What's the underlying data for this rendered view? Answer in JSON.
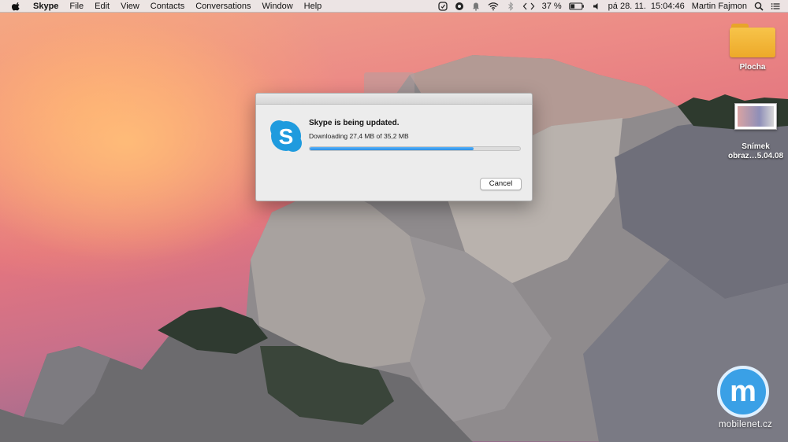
{
  "menubar": {
    "apple_icon": "apple-icon",
    "app_name": "Skype",
    "menus": [
      "File",
      "Edit",
      "View",
      "Contacts",
      "Conversations",
      "Window",
      "Help"
    ],
    "status_icons": [
      "skype-status-icon",
      "compass-icon",
      "notification-icon",
      "wifi-icon",
      "bluetooth-icon",
      "code-brackets-icon"
    ],
    "battery_percent": "37 %",
    "battery_level": 0.37,
    "volume_icon": "speaker-icon",
    "datetime": "pá 28. 11.  15:04:46",
    "user_name": "Martin Fajmon",
    "search_icon": "spotlight-search-icon",
    "notification_center_icon": "list-icon"
  },
  "desktop_icons": [
    {
      "type": "folder",
      "label": "Plocha"
    },
    {
      "type": "screenshot",
      "label_line1": "Snímek",
      "label_line2": "obraz…5.04.08"
    }
  ],
  "dialog": {
    "icon": "skype-logo-icon",
    "title": "Skype is being updated.",
    "status": "Downloading 27,4 MB of 35,2 MB",
    "progress": 0.778,
    "cancel_label": "Cancel"
  },
  "watermark": {
    "logo_letter": "m",
    "text": "mobilenet.cz"
  },
  "colors": {
    "progress_fill": "#2a8fe6",
    "skype_blue": "#1f9bde",
    "watermark_blue": "#3aa0e6"
  }
}
